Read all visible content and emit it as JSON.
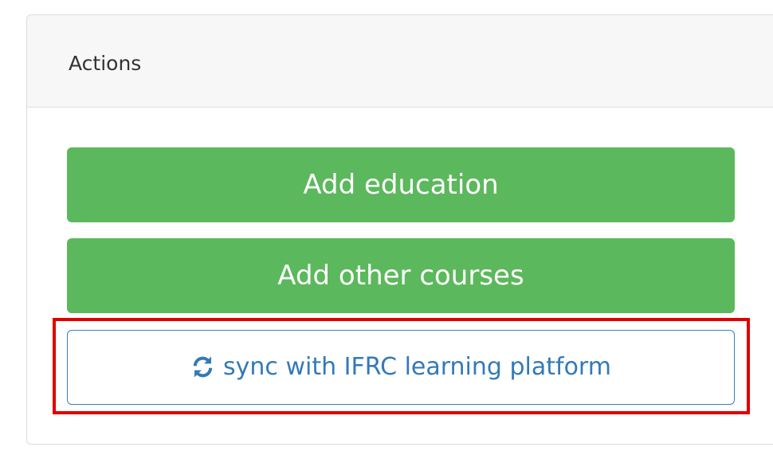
{
  "panel": {
    "title": "Actions"
  },
  "actions": {
    "add_education_label": "Add education",
    "add_other_courses_label": "Add other courses",
    "sync_label": "sync with IFRC learning platform",
    "sync_icon": "sync-icon"
  },
  "colors": {
    "primary_green": "#5cb85c",
    "sync_text": "#337ab7",
    "sync_border": "#3b7fb8",
    "highlight_border": "#e00000",
    "header_background": "#f7f7f7",
    "panel_border": "#dcdcdc"
  }
}
